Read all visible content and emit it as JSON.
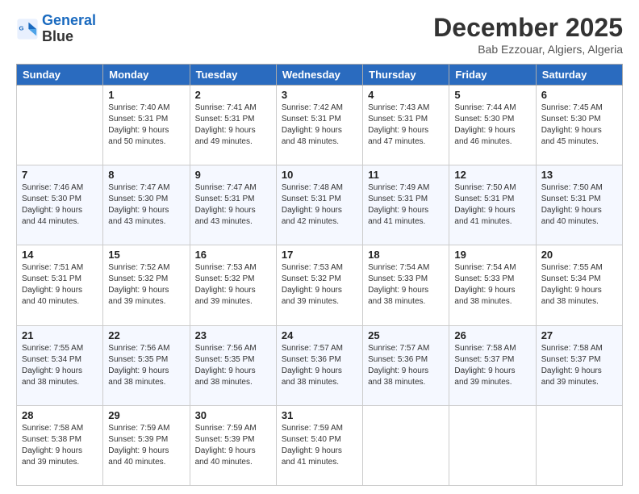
{
  "logo": {
    "line1": "General",
    "line2": "Blue"
  },
  "title": "December 2025",
  "location": "Bab Ezzouar, Algiers, Algeria",
  "days_of_week": [
    "Sunday",
    "Monday",
    "Tuesday",
    "Wednesday",
    "Thursday",
    "Friday",
    "Saturday"
  ],
  "weeks": [
    [
      {
        "day": "",
        "info": ""
      },
      {
        "day": "1",
        "info": "Sunrise: 7:40 AM\nSunset: 5:31 PM\nDaylight: 9 hours\nand 50 minutes."
      },
      {
        "day": "2",
        "info": "Sunrise: 7:41 AM\nSunset: 5:31 PM\nDaylight: 9 hours\nand 49 minutes."
      },
      {
        "day": "3",
        "info": "Sunrise: 7:42 AM\nSunset: 5:31 PM\nDaylight: 9 hours\nand 48 minutes."
      },
      {
        "day": "4",
        "info": "Sunrise: 7:43 AM\nSunset: 5:31 PM\nDaylight: 9 hours\nand 47 minutes."
      },
      {
        "day": "5",
        "info": "Sunrise: 7:44 AM\nSunset: 5:30 PM\nDaylight: 9 hours\nand 46 minutes."
      },
      {
        "day": "6",
        "info": "Sunrise: 7:45 AM\nSunset: 5:30 PM\nDaylight: 9 hours\nand 45 minutes."
      }
    ],
    [
      {
        "day": "7",
        "info": "Sunrise: 7:46 AM\nSunset: 5:30 PM\nDaylight: 9 hours\nand 44 minutes."
      },
      {
        "day": "8",
        "info": "Sunrise: 7:47 AM\nSunset: 5:30 PM\nDaylight: 9 hours\nand 43 minutes."
      },
      {
        "day": "9",
        "info": "Sunrise: 7:47 AM\nSunset: 5:31 PM\nDaylight: 9 hours\nand 43 minutes."
      },
      {
        "day": "10",
        "info": "Sunrise: 7:48 AM\nSunset: 5:31 PM\nDaylight: 9 hours\nand 42 minutes."
      },
      {
        "day": "11",
        "info": "Sunrise: 7:49 AM\nSunset: 5:31 PM\nDaylight: 9 hours\nand 41 minutes."
      },
      {
        "day": "12",
        "info": "Sunrise: 7:50 AM\nSunset: 5:31 PM\nDaylight: 9 hours\nand 41 minutes."
      },
      {
        "day": "13",
        "info": "Sunrise: 7:50 AM\nSunset: 5:31 PM\nDaylight: 9 hours\nand 40 minutes."
      }
    ],
    [
      {
        "day": "14",
        "info": "Sunrise: 7:51 AM\nSunset: 5:31 PM\nDaylight: 9 hours\nand 40 minutes."
      },
      {
        "day": "15",
        "info": "Sunrise: 7:52 AM\nSunset: 5:32 PM\nDaylight: 9 hours\nand 39 minutes."
      },
      {
        "day": "16",
        "info": "Sunrise: 7:53 AM\nSunset: 5:32 PM\nDaylight: 9 hours\nand 39 minutes."
      },
      {
        "day": "17",
        "info": "Sunrise: 7:53 AM\nSunset: 5:32 PM\nDaylight: 9 hours\nand 39 minutes."
      },
      {
        "day": "18",
        "info": "Sunrise: 7:54 AM\nSunset: 5:33 PM\nDaylight: 9 hours\nand 38 minutes."
      },
      {
        "day": "19",
        "info": "Sunrise: 7:54 AM\nSunset: 5:33 PM\nDaylight: 9 hours\nand 38 minutes."
      },
      {
        "day": "20",
        "info": "Sunrise: 7:55 AM\nSunset: 5:34 PM\nDaylight: 9 hours\nand 38 minutes."
      }
    ],
    [
      {
        "day": "21",
        "info": "Sunrise: 7:55 AM\nSunset: 5:34 PM\nDaylight: 9 hours\nand 38 minutes."
      },
      {
        "day": "22",
        "info": "Sunrise: 7:56 AM\nSunset: 5:35 PM\nDaylight: 9 hours\nand 38 minutes."
      },
      {
        "day": "23",
        "info": "Sunrise: 7:56 AM\nSunset: 5:35 PM\nDaylight: 9 hours\nand 38 minutes."
      },
      {
        "day": "24",
        "info": "Sunrise: 7:57 AM\nSunset: 5:36 PM\nDaylight: 9 hours\nand 38 minutes."
      },
      {
        "day": "25",
        "info": "Sunrise: 7:57 AM\nSunset: 5:36 PM\nDaylight: 9 hours\nand 38 minutes."
      },
      {
        "day": "26",
        "info": "Sunrise: 7:58 AM\nSunset: 5:37 PM\nDaylight: 9 hours\nand 39 minutes."
      },
      {
        "day": "27",
        "info": "Sunrise: 7:58 AM\nSunset: 5:37 PM\nDaylight: 9 hours\nand 39 minutes."
      }
    ],
    [
      {
        "day": "28",
        "info": "Sunrise: 7:58 AM\nSunset: 5:38 PM\nDaylight: 9 hours\nand 39 minutes."
      },
      {
        "day": "29",
        "info": "Sunrise: 7:59 AM\nSunset: 5:39 PM\nDaylight: 9 hours\nand 40 minutes."
      },
      {
        "day": "30",
        "info": "Sunrise: 7:59 AM\nSunset: 5:39 PM\nDaylight: 9 hours\nand 40 minutes."
      },
      {
        "day": "31",
        "info": "Sunrise: 7:59 AM\nSunset: 5:40 PM\nDaylight: 9 hours\nand 41 minutes."
      },
      {
        "day": "",
        "info": ""
      },
      {
        "day": "",
        "info": ""
      },
      {
        "day": "",
        "info": ""
      }
    ]
  ]
}
